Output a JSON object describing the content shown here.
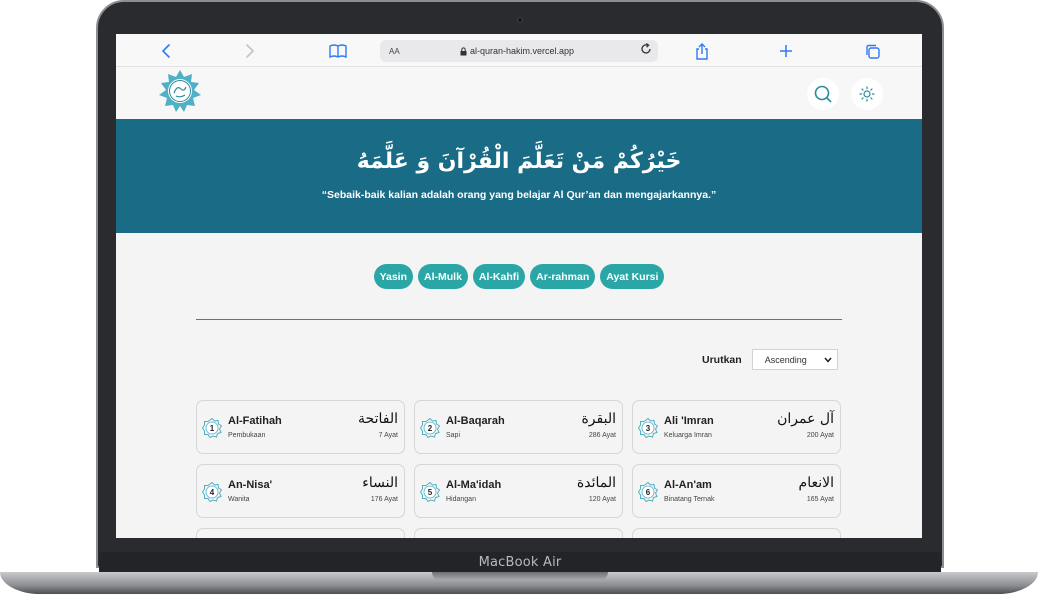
{
  "device": {
    "brand": "MacBook Air"
  },
  "browser": {
    "url": "al-quran-hakim.vercel.app",
    "text_size_label": "AA"
  },
  "banner": {
    "arabic": "خَيْرُكُمْ مَنْ تَعَلَّمَ الْقُرْآنَ وَ عَلَّمَهُ",
    "quote": "“Sebaik-baik kalian adalah orang yang belajar Al Qur’an dan mengajarkannya.”"
  },
  "shortcuts": [
    "Yasin",
    "Al-Mulk",
    "Al-Kahfi",
    "Ar-rahman",
    "Ayat Kursi"
  ],
  "sort": {
    "label": "Urutkan",
    "selected": "Ascending"
  },
  "surahs": [
    {
      "number": "1",
      "name": "Al-Fatihah",
      "meaning": "Pembukaan",
      "arabic": "الفاتحة",
      "ayat": "7 Ayat"
    },
    {
      "number": "2",
      "name": "Al-Baqarah",
      "meaning": "Sapi",
      "arabic": "البقرة",
      "ayat": "286 Ayat"
    },
    {
      "number": "3",
      "name": "Ali 'Imran",
      "meaning": "Keluarga Imran",
      "arabic": "آل عمران",
      "ayat": "200 Ayat"
    },
    {
      "number": "4",
      "name": "An-Nisa'",
      "meaning": "Wanita",
      "arabic": "النساء",
      "ayat": "176 Ayat"
    },
    {
      "number": "5",
      "name": "Al-Ma'idah",
      "meaning": "Hidangan",
      "arabic": "المائدة",
      "ayat": "120 Ayat"
    },
    {
      "number": "6",
      "name": "Al-An'am",
      "meaning": "Binatang Ternak",
      "arabic": "الانعام",
      "ayat": "165 Ayat"
    }
  ],
  "colors": {
    "banner": "#1a6b85",
    "chip": "#2ba6a6",
    "accent": "#2b8aa0",
    "safari_blue": "#2f7bf6"
  }
}
